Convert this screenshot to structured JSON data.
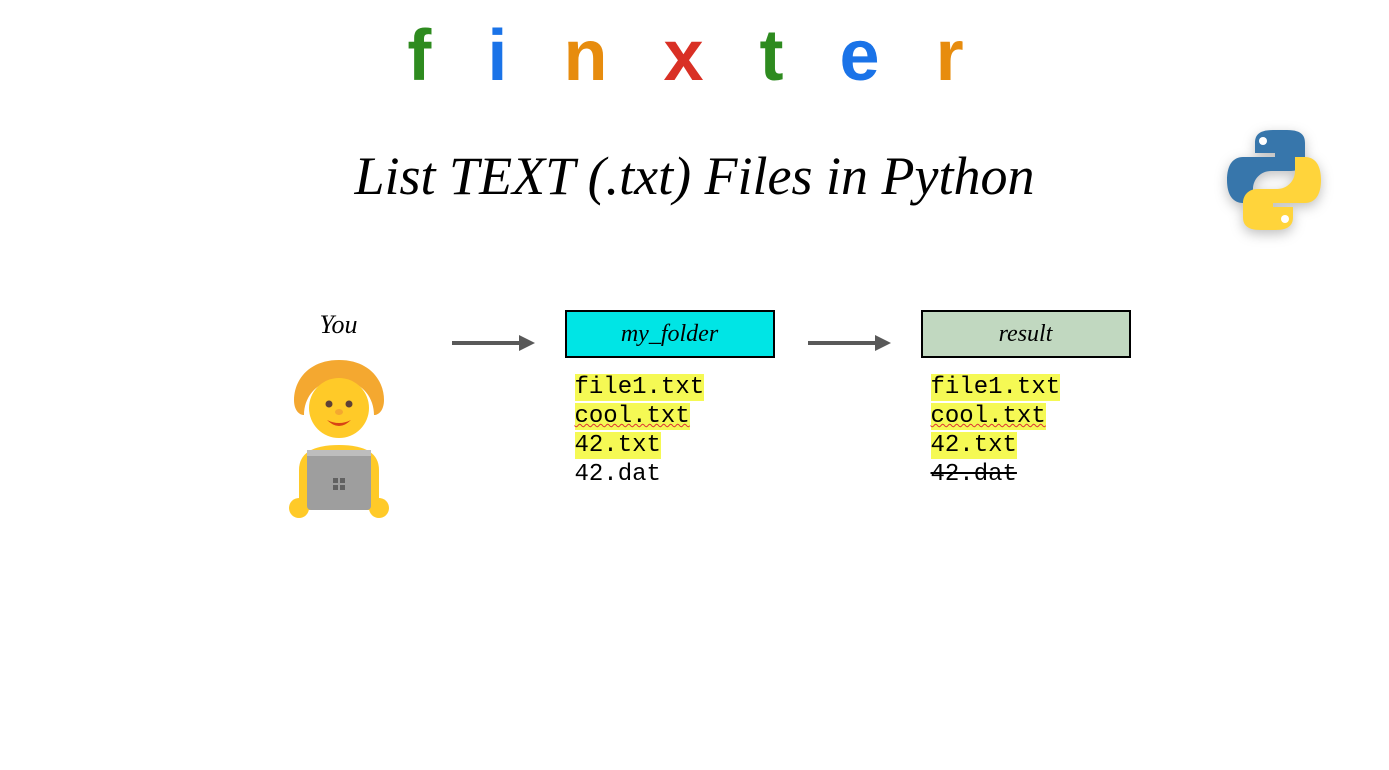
{
  "logo": {
    "letters": [
      {
        "char": "f",
        "color": "#2e8b1f"
      },
      {
        "char": "i",
        "color": "#1a73e8"
      },
      {
        "char": "n",
        "color": "#e78c0e"
      },
      {
        "char": "x",
        "color": "#d93025"
      },
      {
        "char": "t",
        "color": "#2e8b1f"
      },
      {
        "char": "e",
        "color": "#1a73e8"
      },
      {
        "char": "r",
        "color": "#e78c0e"
      }
    ]
  },
  "title": "List TEXT (.txt) Files in Python",
  "diagram": {
    "you_label": "You",
    "folder_label": "my_folder",
    "result_label": "result",
    "folder_files": [
      {
        "name": "file1.txt",
        "highlight": true,
        "strike": false
      },
      {
        "name": "cool.txt",
        "highlight": true,
        "strike": false,
        "underline_wavy": true
      },
      {
        "name": "42.txt",
        "highlight": true,
        "strike": false
      },
      {
        "name": "42.dat",
        "highlight": false,
        "strike": false
      }
    ],
    "result_files": [
      {
        "name": "file1.txt",
        "highlight": true,
        "strike": false
      },
      {
        "name": "cool.txt",
        "highlight": true,
        "strike": false,
        "underline_wavy": true
      },
      {
        "name": "42.txt",
        "highlight": true,
        "strike": false
      },
      {
        "name": "42.dat",
        "highlight": false,
        "strike": true
      }
    ]
  },
  "colors": {
    "folder_box": "#00e5e5",
    "result_box": "#c1d8c0",
    "highlight": "#f5f954",
    "arrow": "#595959"
  }
}
